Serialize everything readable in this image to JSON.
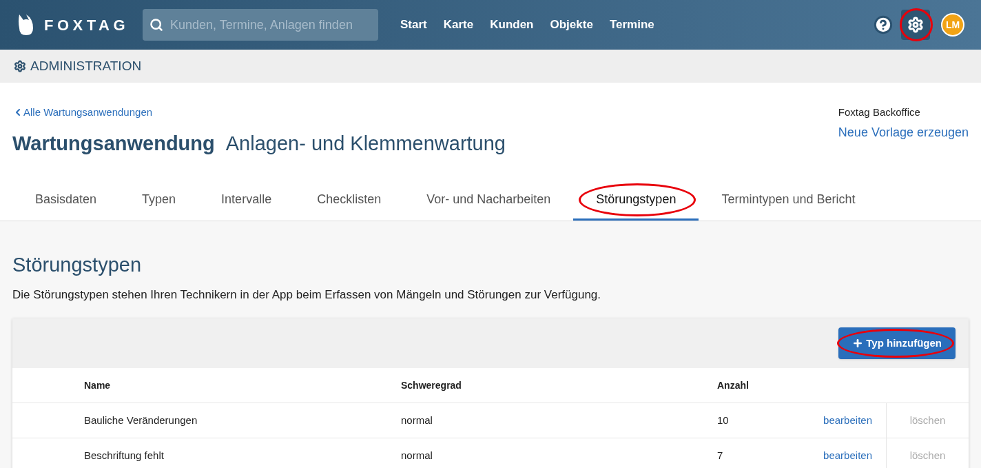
{
  "header": {
    "logo": "FOXTAG",
    "search": {
      "placeholder": "Kunden, Termine, Anlagen finden"
    },
    "nav": [
      "Start",
      "Karte",
      "Kunden",
      "Objekte",
      "Termine"
    ],
    "settings": {
      "highlighted": true
    },
    "avatar": "LM"
  },
  "admin_bar": {
    "title": "ADMINISTRATION"
  },
  "back_link": "Alle Wartungsanwendungen",
  "page_title": {
    "label": "Wartungsanwendung",
    "name": "Anlagen- und Klemmenwartung"
  },
  "owner": {
    "name": "Foxtag Backoffice",
    "link": "Neue Vorlage erzeugen"
  },
  "tabs": [
    {
      "label": "Basisdaten",
      "selected": false,
      "highlighted": false
    },
    {
      "label": "Typen",
      "selected": false,
      "highlighted": false
    },
    {
      "label": "Intervalle",
      "selected": false,
      "highlighted": false
    },
    {
      "label": "Checklisten",
      "selected": false,
      "highlighted": false
    },
    {
      "label": "Vor- und Nacharbeiten",
      "selected": false,
      "highlighted": false
    },
    {
      "label": "Störungstypen",
      "selected": true,
      "highlighted": true
    },
    {
      "label": "Termintypen und Bericht",
      "selected": false,
      "highlighted": false
    }
  ],
  "section": {
    "title": "Störungstypen",
    "description": "Die Störungstypen stehen Ihren Technikern in der App beim Erfassen von Mängeln und Störungen zur Verfügung."
  },
  "add_button": {
    "label": "Typ hinzufügen",
    "highlighted": true
  },
  "table": {
    "columns": [
      "Name",
      "Schweregrad",
      "Anzahl"
    ],
    "rows": [
      {
        "name": "Bauliche Veränderungen",
        "severity": "normal",
        "count": "10",
        "edit": "bearbeiten",
        "delete": "löschen"
      },
      {
        "name": "Beschriftung fehlt",
        "severity": "normal",
        "count": "7",
        "edit": "bearbeiten",
        "delete": "löschen"
      }
    ]
  }
}
